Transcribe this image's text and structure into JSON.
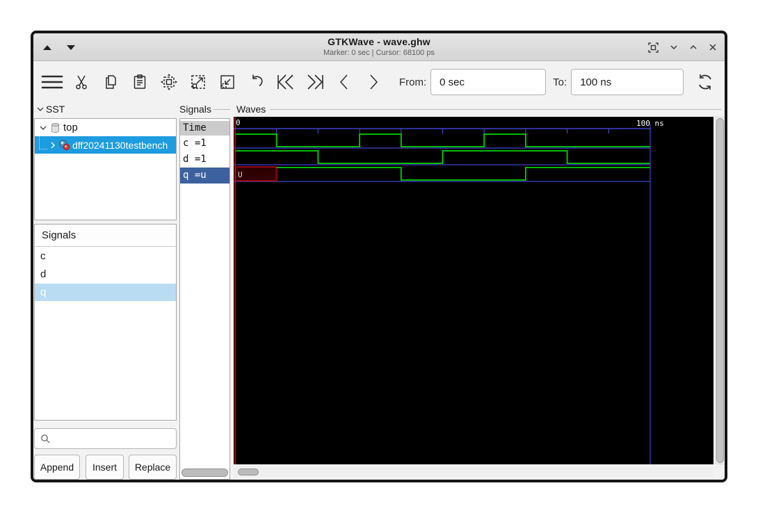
{
  "window": {
    "title": "GTKWave - wave.ghw",
    "subtitle": "Marker: 0 sec | Cursor: 68100 ps"
  },
  "toolbar": {
    "from_label": "From:",
    "from_value": "0 sec",
    "to_label": "To:",
    "to_value": "100 ns"
  },
  "sst": {
    "header": "SST",
    "root": "top",
    "instance": "dff20241130testbench"
  },
  "signal_browser": {
    "header": "Signals",
    "items": [
      {
        "name": "c",
        "selected": false
      },
      {
        "name": "d",
        "selected": false
      },
      {
        "name": "q",
        "selected": true
      }
    ]
  },
  "search": {
    "value": ""
  },
  "actions": {
    "append": "Append",
    "insert": "Insert",
    "replace": "Replace"
  },
  "signals_panel": {
    "frame_label": "Signals",
    "time_header": "Time",
    "rows": [
      {
        "text": "c =1",
        "selected": false
      },
      {
        "text": "d =1",
        "selected": false
      },
      {
        "text": "q =u",
        "selected": true
      }
    ]
  },
  "waves_panel": {
    "frame_label": "Waves"
  },
  "icons": {
    "titlebar": [
      "shade-up-icon",
      "shade-down-icon",
      "fullscreen-icon",
      "chevron-down-icon",
      "chevron-up-icon",
      "close-icon"
    ],
    "toolbar": [
      "menu-icon",
      "cut-icon",
      "copy-icon",
      "paste-icon",
      "zoom-fit-icon",
      "zoom-in-icon",
      "zoom-out-icon",
      "undo-icon",
      "skip-to-start-icon",
      "skip-to-end-icon",
      "step-left-icon",
      "step-right-icon",
      "reload-icon"
    ],
    "other": [
      "expander-down-icon",
      "expander-right-icon",
      "database-icon",
      "module-icon",
      "search-icon"
    ]
  },
  "chart_data": {
    "type": "digital-waveform",
    "title": "Waves",
    "time_unit": "ns",
    "x_range": [
      0,
      100
    ],
    "tick_interval_ns": 10,
    "start_label": "0",
    "end_label": "100 ns",
    "marker_time_ns": 0,
    "cursor_time_ps": 68100,
    "signals": [
      {
        "name": "c",
        "value_at_marker": "1",
        "segments": [
          {
            "t": 0,
            "v": "1"
          },
          {
            "t": 10,
            "v": "0"
          },
          {
            "t": 30,
            "v": "1"
          },
          {
            "t": 40,
            "v": "0"
          },
          {
            "t": 60,
            "v": "1"
          },
          {
            "t": 70,
            "v": "0"
          }
        ]
      },
      {
        "name": "d",
        "value_at_marker": "1",
        "segments": [
          {
            "t": 0,
            "v": "1"
          },
          {
            "t": 20,
            "v": "0"
          },
          {
            "t": 50,
            "v": "1"
          },
          {
            "t": 80,
            "v": "0"
          }
        ]
      },
      {
        "name": "q",
        "value_at_marker": "u",
        "segments": [
          {
            "t": 0,
            "v": "U"
          },
          {
            "t": 10,
            "v": "1"
          },
          {
            "t": 40,
            "v": "0"
          },
          {
            "t": 70,
            "v": "1"
          }
        ]
      }
    ],
    "colors": {
      "wave": "#00d200",
      "grid": "#4343cb",
      "marker": "#bd1414",
      "undef_fill": "#2e0000",
      "undef_border": "#c00000",
      "canvas": "#000000",
      "timeline_text": "#ffffff"
    }
  }
}
